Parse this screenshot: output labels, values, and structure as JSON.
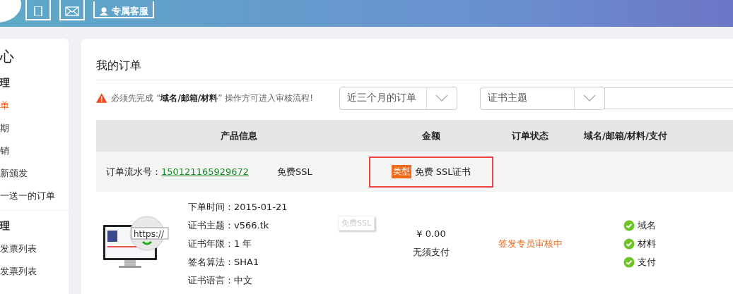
{
  "header": {
    "service_button": "专属客服"
  },
  "sidebar": {
    "title": "心",
    "sections": [
      {
        "heading": "理",
        "items": [
          {
            "label": "单",
            "selected": true
          },
          {
            "label": "期",
            "selected": false
          },
          {
            "label": "销",
            "selected": false
          },
          {
            "label": "新颁发",
            "selected": false
          },
          {
            "label": "一送一的订单",
            "selected": false
          }
        ]
      },
      {
        "heading": "理",
        "items": [
          {
            "label": "发票列表",
            "selected": false
          },
          {
            "label": "发票列表",
            "selected": false
          }
        ]
      }
    ]
  },
  "main": {
    "title": "我的订单",
    "notice": "必须先完成 “**域名/邮箱/材料**” 操作方可进入审核流程!",
    "filters": [
      {
        "value": "近三个月的订单"
      },
      {
        "value": "证书主题"
      }
    ],
    "table": {
      "columns": [
        "产品信息",
        "金额",
        "订单状态",
        "域名/邮箱/材料/支付"
      ],
      "order": {
        "serial_label": "订单流水号：",
        "serial": "150121165929672",
        "product": "免费SSL",
        "type_badge": "类型",
        "type": "免费 SSL证书"
      },
      "details": [
        {
          "label": "下单时间：",
          "value": "2015-01-21"
        },
        {
          "label": "证书主题：",
          "value": "v566.tk"
        },
        {
          "label": "证书年限：",
          "value": "1 年"
        },
        {
          "label": "签名算法：",
          "value": "SHA1"
        },
        {
          "label": "证书语言：",
          "value": "中文"
        }
      ],
      "image_text": "https://",
      "tag": "免费SSL",
      "amount": "¥ 0.00",
      "payment": "无须支付",
      "status": "签发专员审核中",
      "steps": [
        {
          "label": "域名",
          "checked": true
        },
        {
          "label": "材料",
          "checked": true
        },
        {
          "label": "支付",
          "checked": true
        }
      ]
    }
  }
}
